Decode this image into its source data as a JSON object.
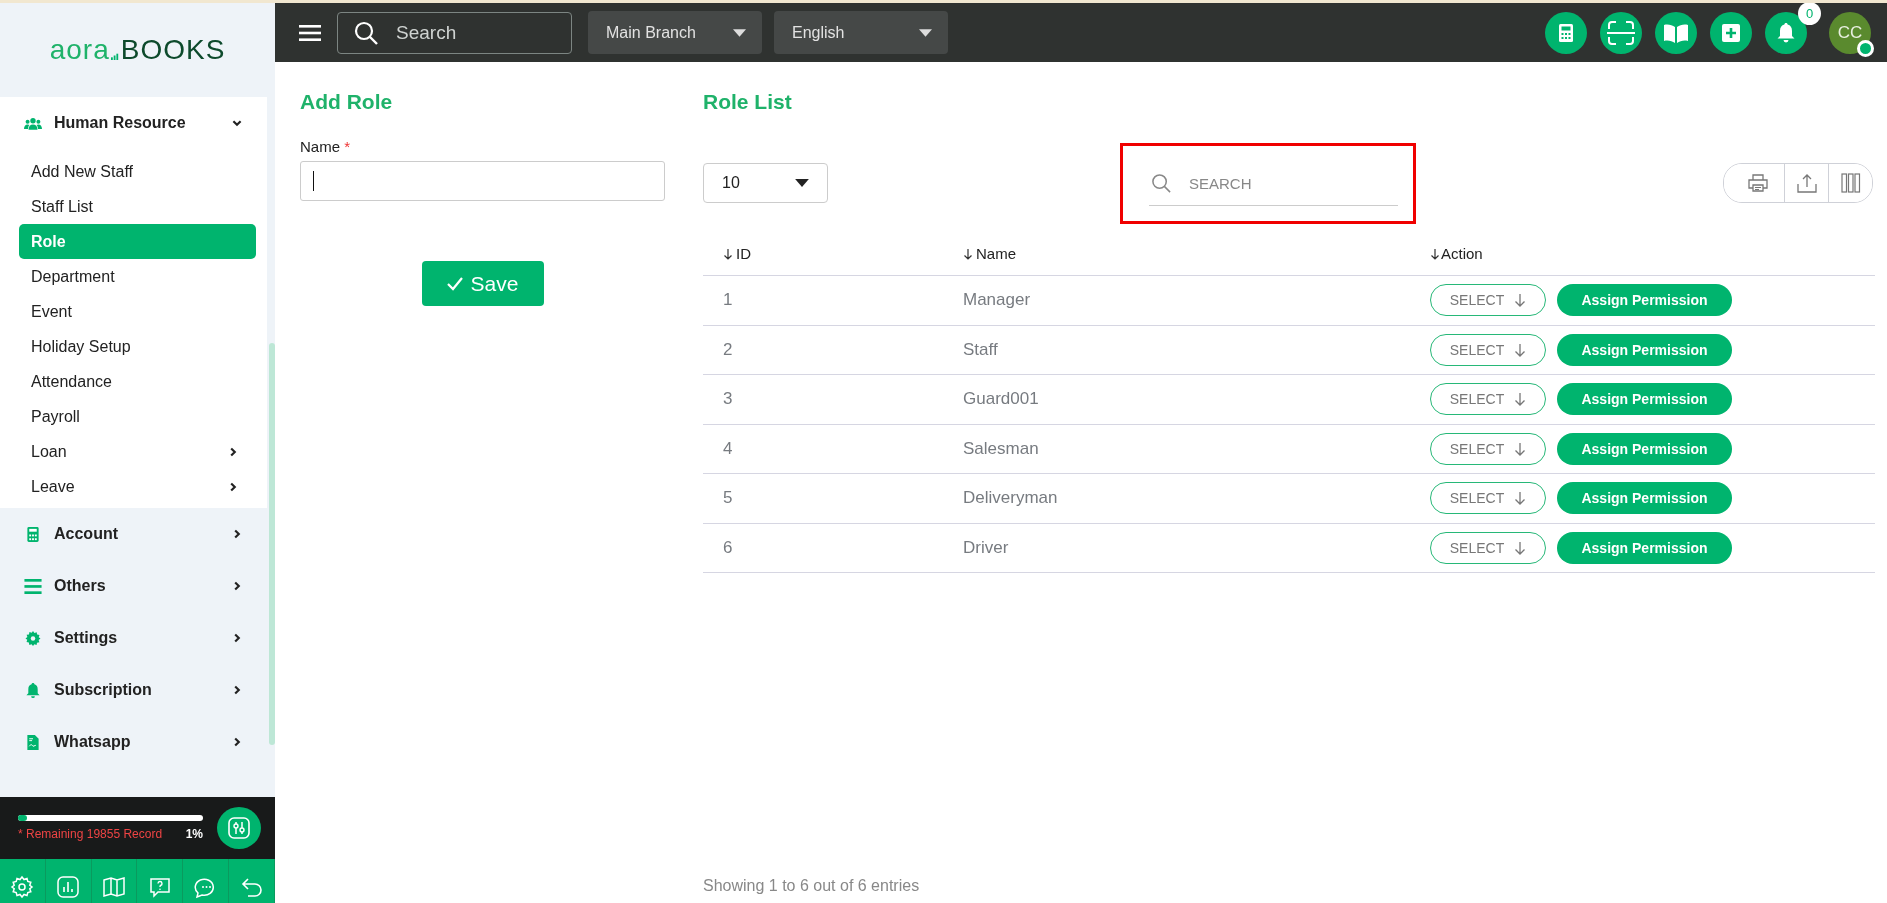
{
  "sidebar": {
    "logo": {
      "part_1": "aora",
      "part_2": "BOOKS"
    },
    "groups": [
      {
        "label": "Human Resource",
        "kind": "users",
        "expanded": true,
        "children": [
          {
            "label": "Add New Staff",
            "selected": false,
            "has_submenu": false
          },
          {
            "label": "Staff List",
            "selected": false,
            "has_submenu": false
          },
          {
            "label": "Role",
            "selected": true,
            "has_submenu": false
          },
          {
            "label": "Department",
            "selected": false,
            "has_submenu": false
          },
          {
            "label": "Event",
            "selected": false,
            "has_submenu": false
          },
          {
            "label": "Holiday Setup",
            "selected": false,
            "has_submenu": false
          },
          {
            "label": "Attendance",
            "selected": false,
            "has_submenu": false
          },
          {
            "label": "Payroll",
            "selected": false,
            "has_submenu": false
          },
          {
            "label": "Loan",
            "selected": false,
            "has_submenu": true
          },
          {
            "label": "Leave",
            "selected": false,
            "has_submenu": true
          }
        ]
      },
      {
        "label": "Account",
        "kind": "calculator",
        "expanded": false
      },
      {
        "label": "Others",
        "kind": "list",
        "expanded": false
      },
      {
        "label": "Settings",
        "kind": "gear",
        "expanded": false
      },
      {
        "label": "Subscription",
        "kind": "bell",
        "expanded": false
      },
      {
        "label": "Whatsapp",
        "kind": "document",
        "expanded": false
      }
    ],
    "usage": {
      "level": 0.05,
      "text": "* Remaining 19855 Record",
      "percent": "1%"
    }
  },
  "topbar": {
    "search": {
      "placeholder": "Search"
    },
    "branch": "Main Branch",
    "language": "English",
    "notifications": "0",
    "avatar": "CC",
    "online": true
  },
  "add_role": {
    "title": "Add Role",
    "field_label": "Name",
    "required_mark": "*",
    "save_label": "Save"
  },
  "role_list": {
    "title": "Role List",
    "page_size": "10",
    "search": {
      "placeholder": "SEARCH",
      "highlighted": true
    },
    "columns": [
      "ID",
      "Name",
      "Action"
    ],
    "rows": [
      {
        "id": "1",
        "name": "Manager",
        "select_label": "SELECT",
        "action_label": "Assign Permission"
      },
      {
        "id": "2",
        "name": "Staff",
        "select_label": "SELECT",
        "action_label": "Assign Permission"
      },
      {
        "id": "3",
        "name": "Guard001",
        "select_label": "SELECT",
        "action_label": "Assign Permission"
      },
      {
        "id": "4",
        "name": "Salesman",
        "select_label": "SELECT",
        "action_label": "Assign Permission"
      },
      {
        "id": "5",
        "name": "Deliveryman",
        "select_label": "SELECT",
        "action_label": "Assign Permission"
      },
      {
        "id": "6",
        "name": "Driver",
        "select_label": "SELECT",
        "action_label": "Assign Permission"
      }
    ],
    "footer": "Showing 1 to 6 out of 6 entries"
  }
}
